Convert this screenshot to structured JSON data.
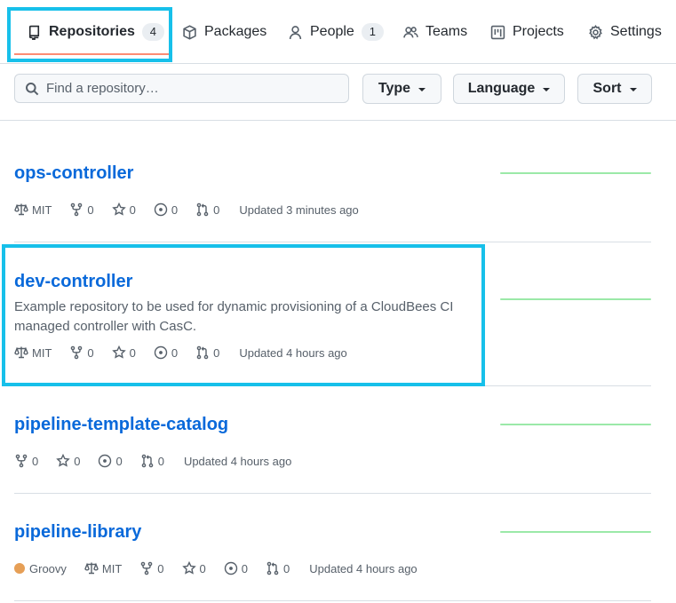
{
  "tabs": [
    {
      "label": "Repositories",
      "count": "4",
      "icon": "repo-icon",
      "active": true
    },
    {
      "label": "Packages",
      "icon": "package-icon"
    },
    {
      "label": "People",
      "count": "1",
      "icon": "person-icon"
    },
    {
      "label": "Teams",
      "icon": "people-icon"
    },
    {
      "label": "Projects",
      "icon": "project-icon"
    },
    {
      "label": "Settings",
      "icon": "gear-icon"
    }
  ],
  "search": {
    "placeholder": "Find a repository…",
    "value": ""
  },
  "filters": {
    "type_label": "Type",
    "language_label": "Language",
    "sort_label": "Sort"
  },
  "colors": {
    "accent_highlight": "#17c0ea",
    "link": "#0969da",
    "groovy": "#e69f56",
    "spark": "#9be9a8",
    "tab_underline": "#fd8c73"
  },
  "repos": [
    {
      "name": "ops-controller",
      "description": "",
      "license": "MIT",
      "forks": "0",
      "stars": "0",
      "issues": "0",
      "pulls": "0",
      "updated": "Updated 3 minutes ago"
    },
    {
      "name": "dev-controller",
      "description": "Example repository to be used for dynamic provisioning of a CloudBees CI managed controller with CasC.",
      "license": "MIT",
      "forks": "0",
      "stars": "0",
      "issues": "0",
      "pulls": "0",
      "updated": "Updated 4 hours ago"
    },
    {
      "name": "pipeline-template-catalog",
      "description": "",
      "forks": "0",
      "stars": "0",
      "issues": "0",
      "pulls": "0",
      "updated": "Updated 4 hours ago"
    },
    {
      "name": "pipeline-library",
      "description": "",
      "language": "Groovy",
      "license": "MIT",
      "forks": "0",
      "stars": "0",
      "issues": "0",
      "pulls": "0",
      "updated": "Updated 4 hours ago"
    }
  ]
}
